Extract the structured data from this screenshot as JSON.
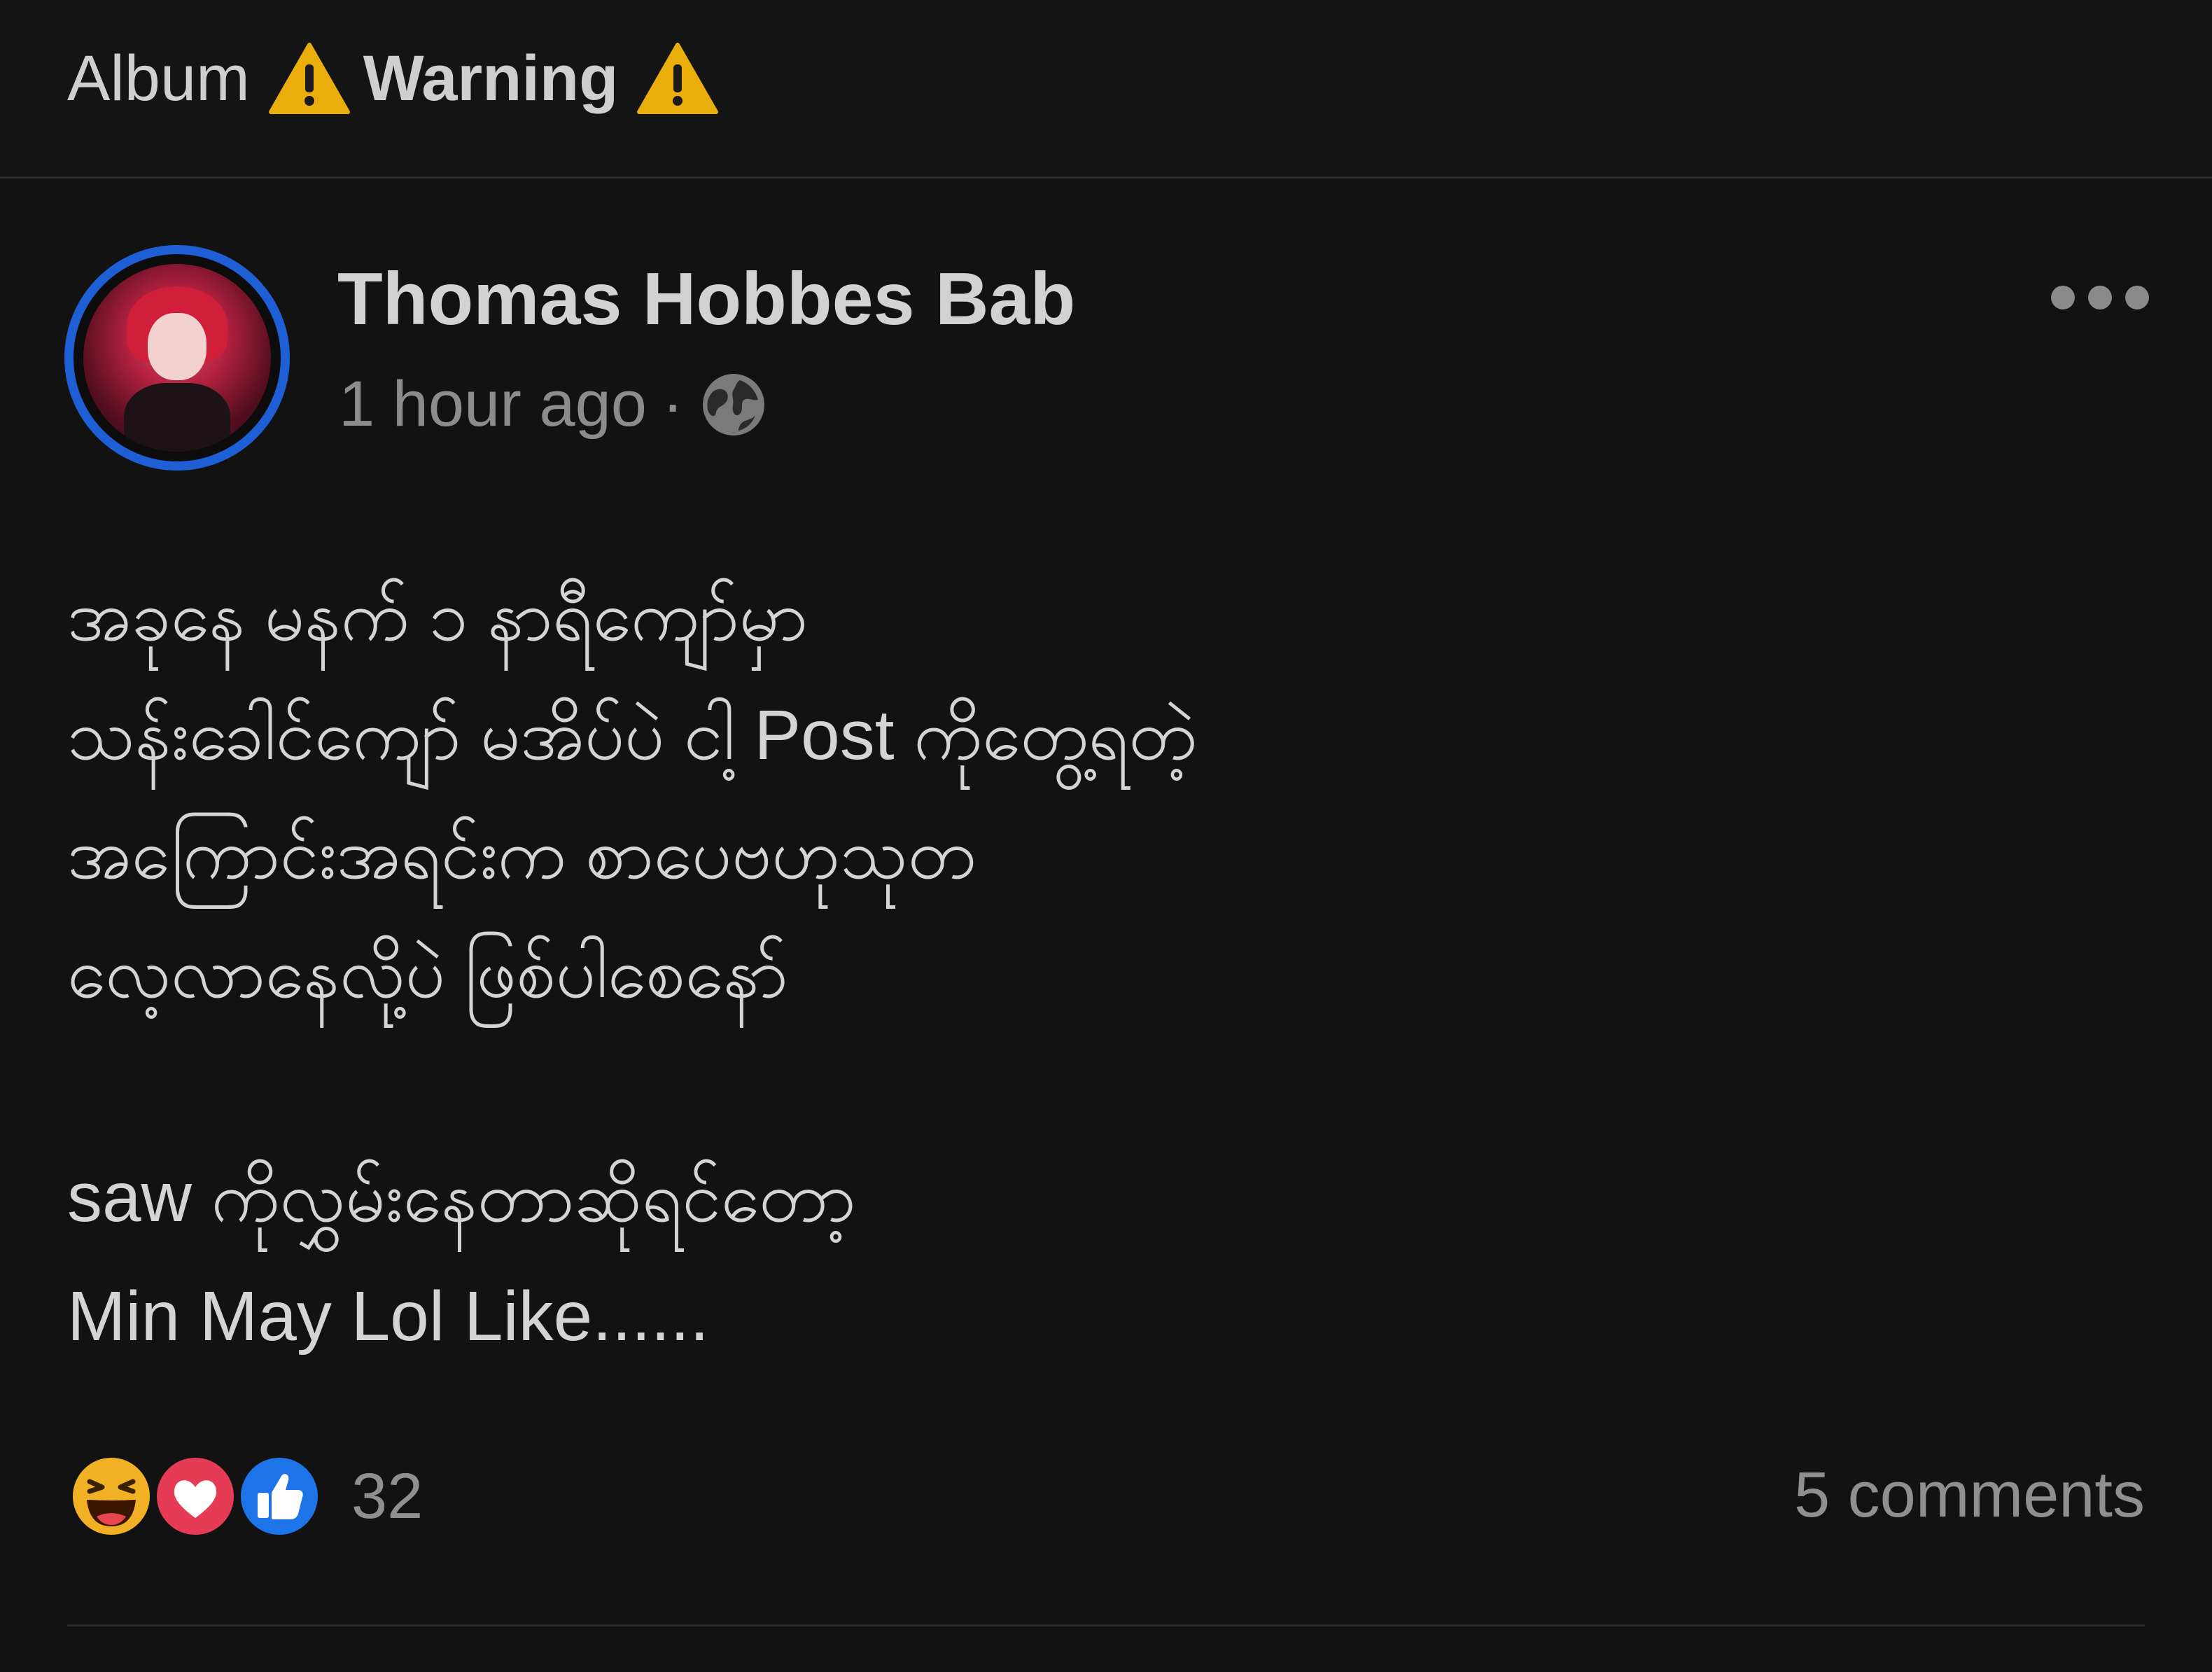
{
  "header": {
    "album_label": "Album",
    "warning_label": "Warning",
    "warning_icon": "warning-triangle-icon"
  },
  "post": {
    "author": "Thomas Hobbes Bab",
    "time": "1 hour ago",
    "separator": "·",
    "privacy_icon": "globe-icon",
    "more_icon": "more-options-icon",
    "body_lines": [
      "အခုနေ မနက် ၁ နာရီကျော်မှာ",
      "သန်းခေါင်ကျော် မအိပ်ပဲ ငါ့ Post ကိုတွေ့ရတဲ့",
      "အကြောင်းအရင်းက စာပေဗဟုသုတ",
      "လေ့လာနေလို့ပဲ ဖြစ်ပါစေနော်",
      "saw ကိုလွှမ်းနေတာဆိုရင်တော့",
      "Min May Lol Like......"
    ],
    "reactions": {
      "icons": [
        "haha-icon",
        "love-icon",
        "like-icon"
      ],
      "count": "32"
    },
    "comments": "5 comments"
  },
  "colors": {
    "background": "#121212",
    "avatar_ring": "#1f5fd6",
    "warning_yellow": "#f2b705",
    "like_blue": "#1877f2",
    "love_red": "#f33e58",
    "haha_yellow": "#f7b125"
  }
}
